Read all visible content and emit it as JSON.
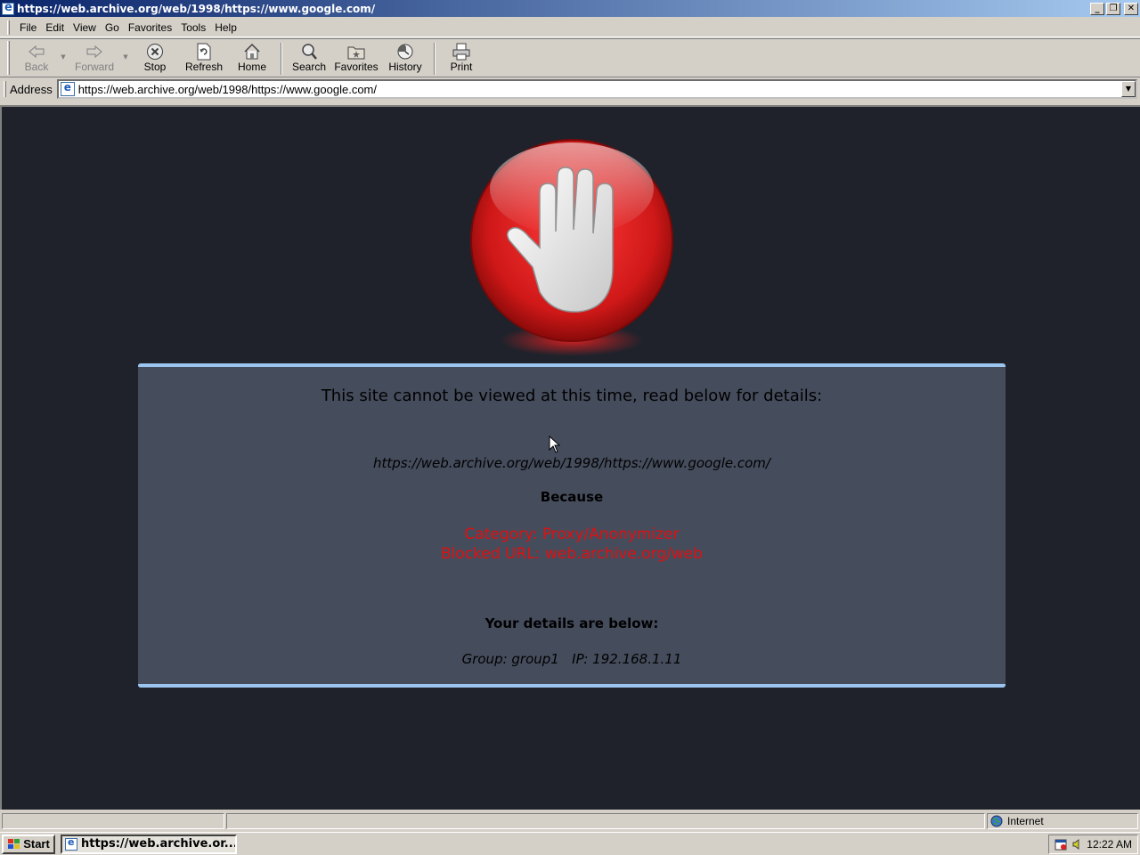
{
  "window": {
    "title": "https://web.archive.org/web/1998/https://www.google.com/",
    "controls": {
      "minimize": "_",
      "restore": "❐",
      "close": "✕"
    }
  },
  "menu": [
    "File",
    "Edit",
    "View",
    "Go",
    "Favorites",
    "Tools",
    "Help"
  ],
  "toolbar": {
    "back": "Back",
    "forward": "Forward",
    "stop": "Stop",
    "refresh": "Refresh",
    "home": "Home",
    "search": "Search",
    "favorites": "Favorites",
    "history": "History",
    "print": "Print"
  },
  "address": {
    "label": "Address",
    "value": "https://web.archive.org/web/1998/https://www.google.com/"
  },
  "block_page": {
    "heading": "This site cannot be viewed at this time, read below for details:",
    "url": "https://web.archive.org/web/1998/https://www.google.com/",
    "because": "Because",
    "category": "Category: Proxy/Anonymizer",
    "blocked_url": "Blocked URL: web.archive.org/web",
    "details_heading": "Your details are below:",
    "details": "Group: group1   IP: 192.168.1.11"
  },
  "status": {
    "zone": "Internet"
  },
  "taskbar": {
    "start": "Start",
    "task": "https://web.archive.or...",
    "clock": "12:22 AM"
  },
  "colors": {
    "content_bg": "#1f222b",
    "panel_bg": "#454c5c",
    "panel_border": "#9cc6f0",
    "reason_text": "#e11010",
    "stop_red": "#d01818"
  }
}
